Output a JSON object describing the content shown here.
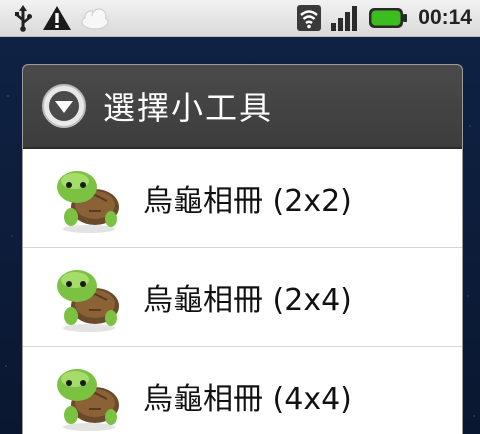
{
  "status_bar": {
    "icons": [
      "usb-icon",
      "warning-icon",
      "cloud-icon",
      "wifi-icon",
      "signal-icon",
      "battery-icon"
    ],
    "time": "00:14"
  },
  "dialog": {
    "title": "選擇小工具",
    "header_icon": "chevron-down-circle-icon",
    "items": [
      {
        "label": "烏龜相冊 (2x2)",
        "icon": "turtle-icon"
      },
      {
        "label": "烏龜相冊 (2x4)",
        "icon": "turtle-icon"
      },
      {
        "label": "烏龜相冊 (4x4)",
        "icon": "turtle-icon"
      }
    ]
  },
  "colors": {
    "header_bg": "#434343",
    "battery_green": "#3bbd1f",
    "turtle_green": "#7cc242",
    "turtle_shell": "#6b4a2b"
  }
}
